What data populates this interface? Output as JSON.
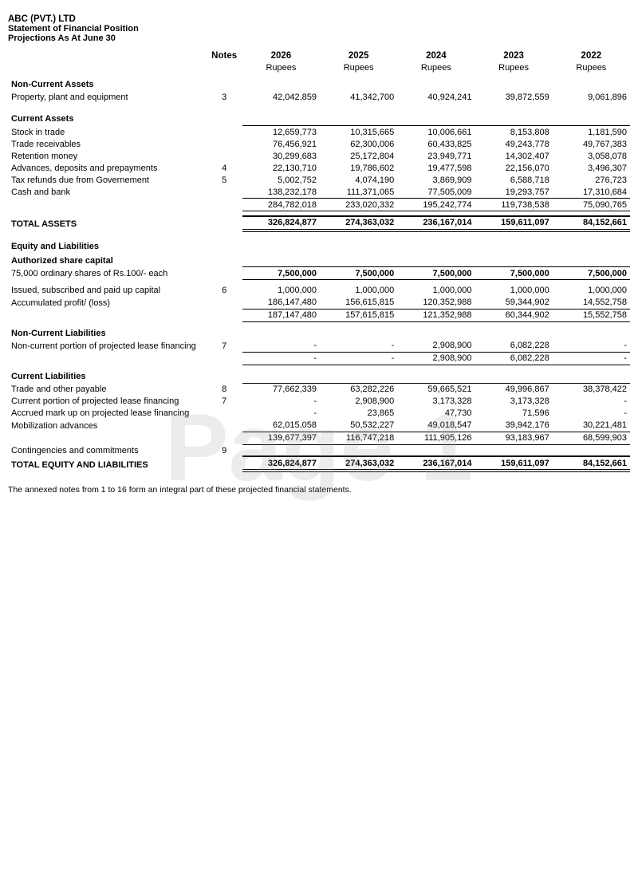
{
  "company": {
    "name": "ABC (PVT.) LTD",
    "statement": "Statement of Financial Position",
    "projection": "Projections As At June 30"
  },
  "columns": {
    "notes": "Notes",
    "years": [
      "2026",
      "2025",
      "2024",
      "2023",
      "2022"
    ],
    "unit": "Rupees"
  },
  "sections": {
    "non_current_assets": "Non-Current Assets",
    "current_assets": "Current Assets",
    "total_assets": "TOTAL ASSETS",
    "equity_liabilities": "Equity and Liabilities",
    "auth_share_capital": "Authorized share capital",
    "non_current_liabilities": "Non-Current Liabilities",
    "current_liabilities": "Current Liabilities",
    "total_equity_liabilities": "TOTAL EQUITY AND LIABILITIES"
  },
  "rows": {
    "ppe": {
      "label": "Property, plant and equipment",
      "note": "3",
      "vals": [
        "42,042,859",
        "41,342,700",
        "40,924,241",
        "39,872,559",
        "9,061,896"
      ]
    },
    "stock": {
      "label": "Stock in trade",
      "note": "",
      "vals": [
        "12,659,773",
        "10,315,665",
        "10,006,661",
        "8,153,808",
        "1,181,590"
      ]
    },
    "trade_rec": {
      "label": "Trade receivables",
      "note": "",
      "vals": [
        "76,456,921",
        "62,300,006",
        "60,433,825",
        "49,243,778",
        "49,767,383"
      ]
    },
    "retention": {
      "label": "Retention money",
      "note": "",
      "vals": [
        "30,299,683",
        "25,172,804",
        "23,949,771",
        "14,302,407",
        "3,058,078"
      ]
    },
    "advances": {
      "label": "Advances, deposits and prepayments",
      "note": "4",
      "vals": [
        "22,130,710",
        "19,786,602",
        "19,477,598",
        "22,156,070",
        "3,496,307"
      ]
    },
    "tax_refunds": {
      "label": "Tax refunds due from Governement",
      "note": "5",
      "vals": [
        "5,002,752",
        "4,074,190",
        "3,869,909",
        "6,588,718",
        "276,723"
      ]
    },
    "cash_bank": {
      "label": "Cash and bank",
      "note": "",
      "vals": [
        "138,232,178",
        "111,371,065",
        "77,505,009",
        "19,293,757",
        "17,310,684"
      ]
    },
    "ca_total": {
      "label": "",
      "note": "",
      "vals": [
        "284,782,018",
        "233,020,332",
        "195,242,774",
        "119,738,538",
        "75,090,765"
      ]
    },
    "total_assets": {
      "label": "TOTAL ASSETS",
      "note": "",
      "vals": [
        "326,824,877",
        "274,363,032",
        "236,167,014",
        "159,611,097",
        "84,152,661"
      ]
    },
    "auth_shares": {
      "label": "75,000 ordinary shares of Rs.100/- each",
      "note": "",
      "vals": [
        "7,500,000",
        "7,500,000",
        "7,500,000",
        "7,500,000",
        "7,500,000"
      ]
    },
    "issued": {
      "label": "Issued, subscribed and paid up capital",
      "note": "6",
      "vals": [
        "1,000,000",
        "1,000,000",
        "1,000,000",
        "1,000,000",
        "1,000,000"
      ]
    },
    "acc_profit": {
      "label": "Accumulated profit/ (loss)",
      "note": "",
      "vals": [
        "186,147,480",
        "156,615,815",
        "120,352,988",
        "59,344,902",
        "14,552,758"
      ]
    },
    "equity_subtotal": {
      "label": "",
      "note": "",
      "vals": [
        "187,147,480",
        "157,615,815",
        "121,352,988",
        "60,344,902",
        "15,552,758"
      ]
    },
    "nc_lease": {
      "label": "Non-current portion of projected lease financing",
      "note": "7",
      "vals": [
        "-",
        "-",
        "2,908,900",
        "6,082,228",
        "-"
      ]
    },
    "nc_total": {
      "label": "",
      "note": "",
      "vals": [
        "-",
        "-",
        "2,908,900",
        "6,082,228",
        "-"
      ]
    },
    "trade_payable": {
      "label": "Trade and other payable",
      "note": "8",
      "vals": [
        "77,662,339",
        "63,282,226",
        "59,665,521",
        "49,996,867",
        "38,378,422"
      ]
    },
    "curr_lease": {
      "label": "Current portion of projected lease financing",
      "note": "7",
      "vals": [
        "-",
        "2,908,900",
        "3,173,328",
        "3,173,328",
        "-"
      ]
    },
    "accrued_mark": {
      "label": "Accrued mark up on projected lease financing",
      "note": "",
      "vals": [
        "-",
        "23,865",
        "47,730",
        "71,596",
        "-"
      ]
    },
    "mob_advances": {
      "label": "Mobilization advances",
      "note": "",
      "vals": [
        "62,015,058",
        "50,532,227",
        "49,018,547",
        "39,942,176",
        "30,221,481"
      ]
    },
    "cl_total": {
      "label": "",
      "note": "",
      "vals": [
        "139,677,397",
        "116,747,218",
        "111,905,126",
        "93,183,967",
        "68,599,903"
      ]
    },
    "contingencies": {
      "label": "Contingencies and commitments",
      "note": "9",
      "vals": [
        "",
        "",
        "",
        "",
        ""
      ]
    },
    "total_eq_liab": {
      "label": "TOTAL EQUITY AND LIABILITIES",
      "note": "",
      "vals": [
        "326,824,877",
        "274,363,032",
        "236,167,014",
        "159,611,097",
        "84,152,661"
      ]
    }
  },
  "footnote": "The annexed notes from 1 to 16 form an integral part of these projected financial statements.",
  "watermark": "Page 1"
}
